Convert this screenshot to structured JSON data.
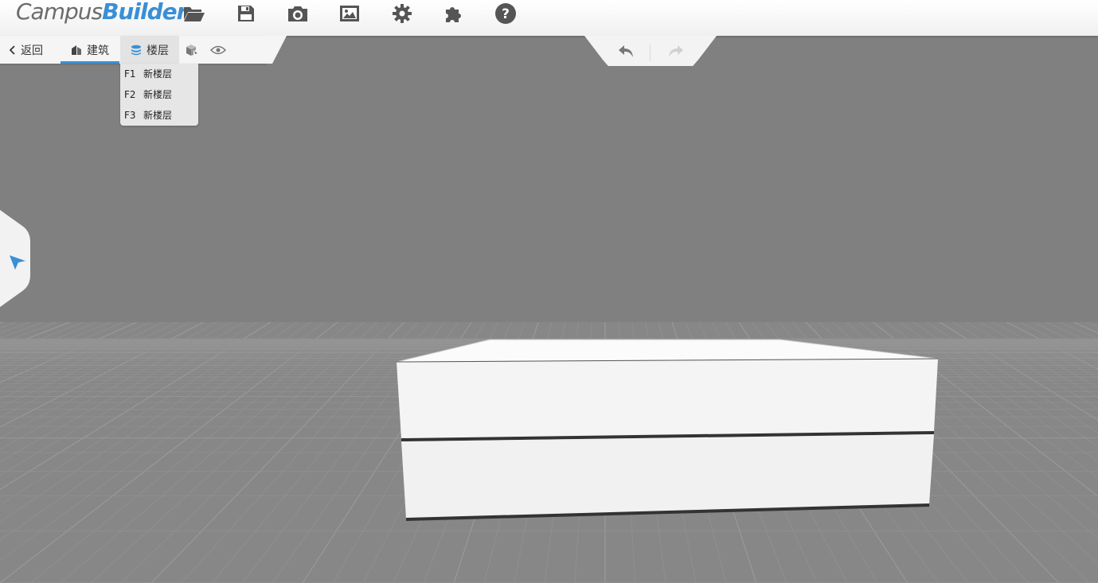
{
  "app": {
    "logo_part1": "Campus",
    "logo_part2": "Builder",
    "accent_color": "#3a8fd6"
  },
  "toolbar": {
    "icons": [
      "folder-open-icon",
      "save-icon",
      "camera-icon",
      "image-icon",
      "gear-icon",
      "puzzle-icon",
      "help-icon"
    ]
  },
  "nav": {
    "back_label": "返回",
    "building_label": "建筑",
    "floor_label": "楼层",
    "active_tab": "building"
  },
  "floor_menu": {
    "items": [
      {
        "code": "F1",
        "name": "新楼层"
      },
      {
        "code": "F2",
        "name": "新楼层"
      },
      {
        "code": "F3",
        "name": "新楼层"
      }
    ]
  },
  "history": {
    "undo_enabled": true,
    "redo_enabled": false
  },
  "side_panel": {
    "tool": "select-arrow-icon"
  }
}
